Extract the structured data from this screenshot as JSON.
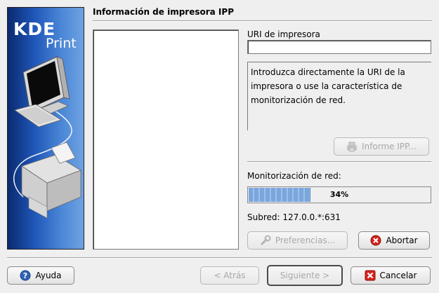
{
  "banner": {
    "logo_kde": "KDE",
    "logo_print": "Print"
  },
  "page": {
    "title": "Información de impresora IPP"
  },
  "uri": {
    "label": "URI de impresora",
    "value": "",
    "placeholder": ""
  },
  "info": {
    "text": "Introduzca directamente la URI de la impresora o use la característica de monitorización de red."
  },
  "buttons": {
    "report": "Informe IPP...",
    "settings": "Preferencias...",
    "abort": "Abortar",
    "help": "Ayuda",
    "back": "< Atrás",
    "next": "Siguiente >",
    "cancel": "Cancelar"
  },
  "monitor": {
    "label": "Monitorización de red:",
    "percent": 34,
    "percent_text": "34%",
    "subnet": "Subred: 127.0.0.*:631"
  },
  "colors": {
    "progress_fill": "#7aa6dc",
    "cancel_red": "#d9221b",
    "help_blue": "#2f63b8"
  },
  "icons": {
    "report": "printer-report-icon",
    "settings": "wrench-icon",
    "abort": "stop-icon",
    "help": "help-icon",
    "cancel": "cancel-icon"
  }
}
